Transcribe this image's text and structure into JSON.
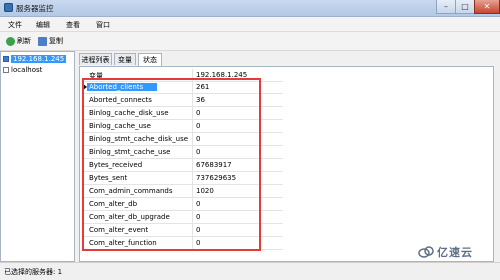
{
  "window": {
    "title": "服务器监控"
  },
  "menu": [
    "文件",
    "编辑",
    "查看",
    "窗口"
  ],
  "toolbar": {
    "refresh": "刷新",
    "copy": "复制"
  },
  "servers": [
    {
      "name": "192.168.1.245",
      "checked": true,
      "selected": true
    },
    {
      "name": "localhost",
      "checked": false,
      "selected": false
    }
  ],
  "tabs": [
    "进程列表",
    "变量",
    "状态"
  ],
  "active_tab": "状态",
  "status_rows": [
    {
      "name": "变量",
      "value": "192.168.1.245"
    },
    {
      "name": "Aborted_clients",
      "value": "261",
      "selected": true
    },
    {
      "name": "Aborted_connects",
      "value": "36"
    },
    {
      "name": "Binlog_cache_disk_use",
      "value": "0"
    },
    {
      "name": "Binlog_cache_use",
      "value": "0"
    },
    {
      "name": "Binlog_stmt_cache_disk_use",
      "value": "0"
    },
    {
      "name": "Binlog_stmt_cache_use",
      "value": "0"
    },
    {
      "name": "Bytes_received",
      "value": "67683917"
    },
    {
      "name": "Bytes_sent",
      "value": "737629635"
    },
    {
      "name": "Com_admin_commands",
      "value": "1020"
    },
    {
      "name": "Com_alter_db",
      "value": "0"
    },
    {
      "name": "Com_alter_db_upgrade",
      "value": "0"
    },
    {
      "name": "Com_alter_event",
      "value": "0"
    },
    {
      "name": "Com_alter_function",
      "value": "0"
    }
  ],
  "statusbar": {
    "text": "已选择的服务器: 1"
  },
  "watermark": {
    "text": "亿速云"
  },
  "colors": {
    "highlight": "#3399ff",
    "annotation_box": "#e53b3b"
  }
}
